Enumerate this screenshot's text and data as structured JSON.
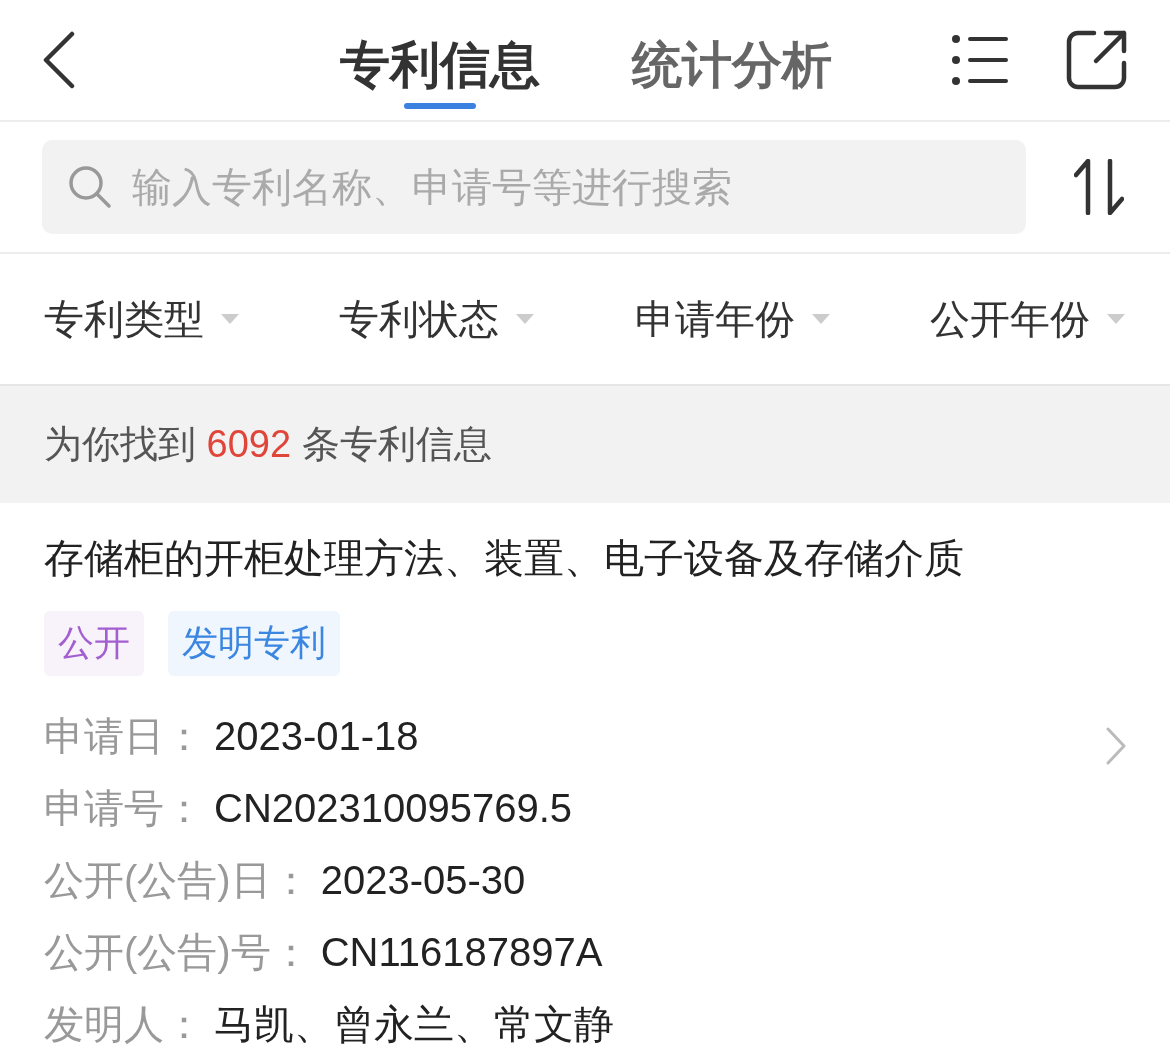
{
  "tabs": [
    {
      "label": "专利信息",
      "selected": true
    },
    {
      "label": "统计分析",
      "selected": false
    }
  ],
  "search": {
    "placeholder": "输入专利名称、申请号等进行搜索"
  },
  "filters": [
    "专利类型",
    "专利状态",
    "申请年份",
    "公开年份"
  ],
  "result": {
    "prefix": "为你找到",
    "count": "6092",
    "suffix": "条专利信息"
  },
  "patent": {
    "title": "存储柜的开柜处理方法、装置、电子设备及存储介质",
    "tags": [
      {
        "label": "公开",
        "color": "#a35fd0"
      },
      {
        "label": "发明专利",
        "color": "#3a86e0"
      }
    ],
    "fields": [
      {
        "label": "申请日：",
        "value": "2023-01-18"
      },
      {
        "label": "申请号：",
        "value": "CN202310095769.5"
      },
      {
        "label": "公开(公告)日：",
        "value": "2023-05-30"
      },
      {
        "label": "公开(公告)号：",
        "value": "CN116187897A"
      },
      {
        "label": "发明人：",
        "value": "马凯、曾永兰、常文静"
      }
    ]
  }
}
